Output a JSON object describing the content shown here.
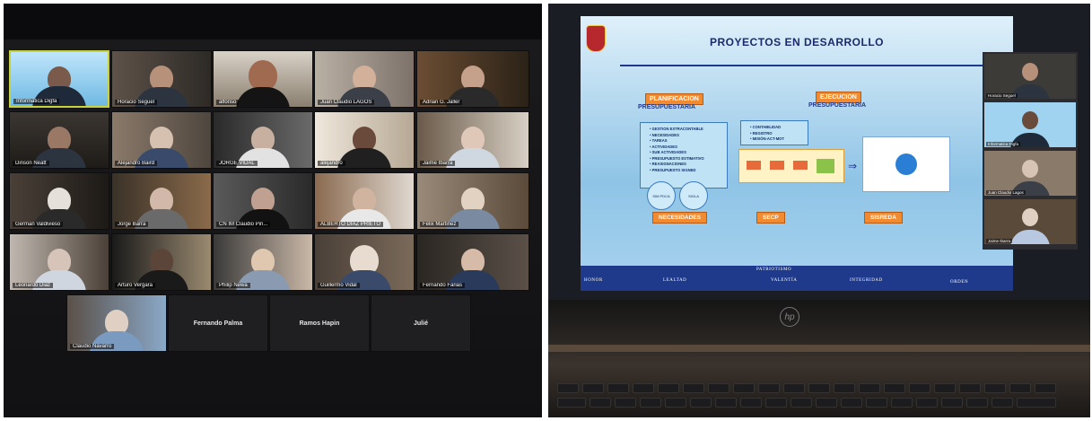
{
  "left_photo": {
    "tiles": [
      {
        "name": "Informatica Digfa"
      },
      {
        "name": "Horacio Seguel"
      },
      {
        "name": "alfonso"
      },
      {
        "name": "Juan Claudio LAGOS"
      },
      {
        "name": "Adrian G. Jaller"
      },
      {
        "name": "Dinson Neatt"
      },
      {
        "name": "Alejandro Baird"
      },
      {
        "name": "JORGE VIDAL"
      },
      {
        "name": "alejandro"
      },
      {
        "name": "Jaime Ibarra"
      },
      {
        "name": "German Valdivieso"
      },
      {
        "name": "Jorge Barra"
      },
      {
        "name": "CN IM Claudio Pin..."
      },
      {
        "name": "ALBERTO DIAZ PRIETO"
      },
      {
        "name": "Felix Martinez"
      },
      {
        "name": "Leonardo Diaz"
      },
      {
        "name": "Arturo Vergara"
      },
      {
        "name": "Philip Newa"
      },
      {
        "name": "Guillermo Vidal"
      },
      {
        "name": "Fernando Farias"
      },
      {
        "name": "Claudio Navarro"
      },
      {
        "name": "Fernando Palma"
      },
      {
        "name": "Ramos Hapin"
      },
      {
        "name": "Julié"
      }
    ]
  },
  "right_photo": {
    "slide": {
      "title": "PROYECTOS EN DESARROLLO",
      "planning_title": "PLANIFICACION",
      "planning_sub": "PRESUPUESTARIA",
      "execution_title": "EJECUCION",
      "execution_sub": "PRESUPUESTARIA",
      "planning_list": [
        "GESTION EXTRACONTABLE",
        "NECESIDADES",
        "TAREAS",
        "ACTIVIDADES",
        "SUB ACTIVIDADES",
        "PRESUPUESTO ESTIMATIVO",
        "REASIGNACIONES",
        "PRESUPUESTO SIGNED"
      ],
      "execution_list": [
        "CONTABILIDAD",
        "REGISTRO",
        "MISIÓN-ACT-MOT"
      ],
      "oval_1": "SIM PDCA",
      "oval_2": "SIGLA",
      "tag_needs": "NECESIDADES",
      "tag_secp": "SECP",
      "tag_sisreda": "SISREDA",
      "footer": {
        "motto": "PATRIOTISMO",
        "words": [
          "HONOR",
          "LEALTAD",
          "VALENTÍA",
          "INTEGRIDAD",
          "ORDEN"
        ]
      }
    },
    "side_tiles": [
      {
        "name": "Horacio Seguel"
      },
      {
        "name": "Informatica Digfa"
      },
      {
        "name": "Juan Claudio Lagos"
      },
      {
        "name": "Jaime Ibarra"
      }
    ],
    "brand": "hp"
  }
}
